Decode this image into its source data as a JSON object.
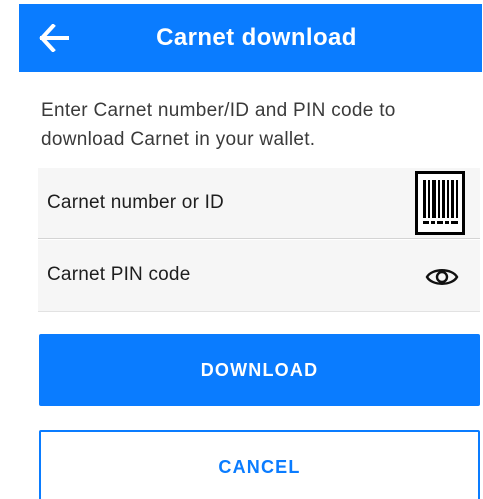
{
  "app_bar": {
    "title": "Carnet download",
    "back_icon": "arrow-left-icon",
    "background_color": "#0a7cff"
  },
  "instructions": "Enter Carnet number/ID and PIN code to download Carnet in your wallet.",
  "fields": {
    "carnet_number": {
      "placeholder": "Carnet number or ID",
      "value": "",
      "icon": "barcode-scan-icon"
    },
    "pin": {
      "placeholder": "Carnet PIN code",
      "value": "",
      "icon": "eye-icon"
    }
  },
  "buttons": {
    "download_label": "DOWNLOAD",
    "cancel_label": "CANCEL"
  },
  "colors": {
    "accent": "#0a7cff",
    "field_background": "#f6f6f6"
  }
}
